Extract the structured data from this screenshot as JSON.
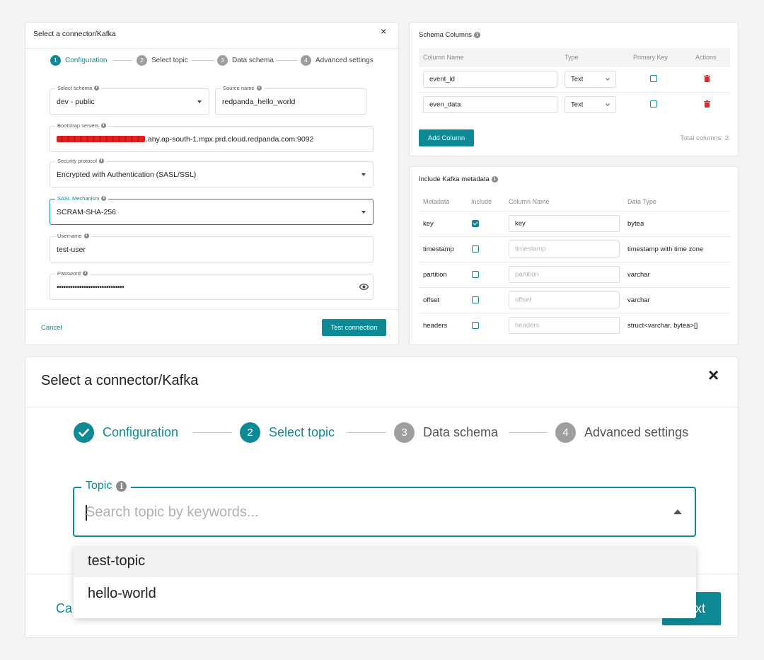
{
  "colors": {
    "accent": "#0e8a96",
    "danger": "#d32f2f",
    "step_inactive": "#9e9e9e"
  },
  "config_card": {
    "title": "Select a connector/Kafka",
    "steps": [
      {
        "num": "1",
        "label": "Configuration",
        "state": "active"
      },
      {
        "num": "2",
        "label": "Select topic",
        "state": "inactive"
      },
      {
        "num": "3",
        "label": "Data schema",
        "state": "inactive"
      },
      {
        "num": "4",
        "label": "Advanced settings",
        "state": "inactive"
      }
    ],
    "fields": {
      "schema": {
        "label": "Select schema",
        "value": "dev - public"
      },
      "source_name": {
        "label": "Source name",
        "value": "redpanda_hello_world"
      },
      "bootstrap": {
        "label": "Bootstrap servers",
        "value": ".any.ap-south-1.mpx.prd.cloud.redpanda.com:9092"
      },
      "security": {
        "label": "Security protocol",
        "value": "Encrypted with Authentication (SASL/SSL)"
      },
      "sasl": {
        "label": "SASL Mechanism",
        "value": "SCRAM-SHA-256"
      },
      "username": {
        "label": "Username",
        "value": "test-user"
      },
      "password": {
        "label": "Password",
        "value": "••••••••••••••••••••••••••••••"
      }
    },
    "cancel": "Cancel",
    "test_connection": "Test connection"
  },
  "schema_card": {
    "title": "Schema Columns",
    "headers": [
      "Column Name",
      "Type",
      "Primary Key",
      "Actions"
    ],
    "rows": [
      {
        "name": "event_id",
        "type": "Text",
        "primary_key": false
      },
      {
        "name": "even_data",
        "type": "Text",
        "primary_key": false
      }
    ],
    "add_column": "Add Column",
    "total": "Total columns: 2"
  },
  "metadata_card": {
    "title": "Include Kafka metadata",
    "headers": [
      "Metadata",
      "Include",
      "Column Name",
      "Data Type"
    ],
    "rows": [
      {
        "metadata": "key",
        "include": true,
        "column": "key",
        "column_is_placeholder": false,
        "type": "bytea"
      },
      {
        "metadata": "timestamp",
        "include": false,
        "column": "timestamp",
        "column_is_placeholder": true,
        "type": "timestamp with time zone"
      },
      {
        "metadata": "partition",
        "include": false,
        "column": "partition",
        "column_is_placeholder": true,
        "type": "varchar"
      },
      {
        "metadata": "offset",
        "include": false,
        "column": "offset",
        "column_is_placeholder": true,
        "type": "varchar"
      },
      {
        "metadata": "headers",
        "include": false,
        "column": "headers",
        "column_is_placeholder": true,
        "type": "struct<varchar, bytea>[]"
      }
    ]
  },
  "topic_dialog": {
    "title": "Select a connector/Kafka",
    "steps": [
      {
        "num": "✓",
        "label": "Configuration",
        "state": "done"
      },
      {
        "num": "2",
        "label": "Select topic",
        "state": "active"
      },
      {
        "num": "3",
        "label": "Data schema",
        "state": "inactive"
      },
      {
        "num": "4",
        "label": "Advanced settings",
        "state": "inactive"
      }
    ],
    "topic_label": "Topic",
    "topic_placeholder": "Search topic by keywords...",
    "options": [
      "test-topic",
      "hello-world"
    ],
    "cancel_partial": "Ca",
    "next_partial": "xt"
  }
}
